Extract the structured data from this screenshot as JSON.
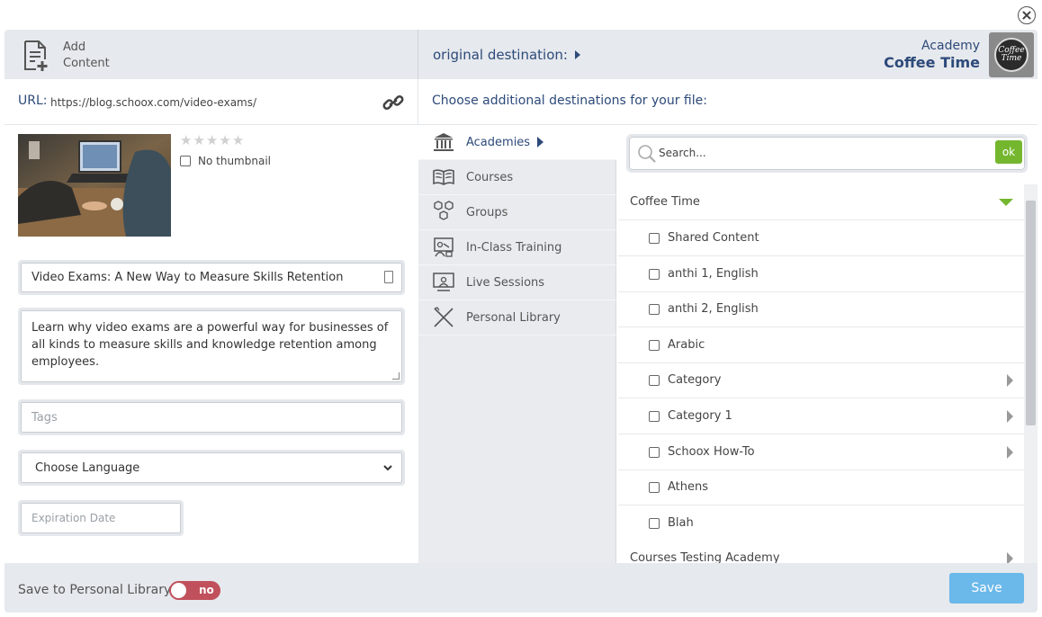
{
  "header": {
    "add_content_line1": "Add",
    "add_content_line2": "Content",
    "original_destination": "original destination:",
    "academy_label": "Academy",
    "academy_name": "Coffee Time",
    "logo_text": "Coffee Time"
  },
  "url": {
    "label": "URL:",
    "value": "https://blog.schoox.com/video-exams/"
  },
  "choose_destinations": "Choose additional destinations for your file:",
  "thumbnail": {
    "rating": 0,
    "no_thumbnail_label": "No thumbnail"
  },
  "form": {
    "title_value": "Video Exams: A New Way to Measure Skills Retention",
    "description_value": "Learn why video exams are a powerful way for businesses of all kinds to measure skills and knowledge retention among employees.",
    "tags_placeholder": "Tags",
    "language_value": "Choose Language",
    "expiration_placeholder": "Expiration Date"
  },
  "nav": {
    "items": [
      {
        "label": "Academies",
        "icon": "academy-icon",
        "active": true
      },
      {
        "label": "Courses",
        "icon": "book-icon",
        "active": false
      },
      {
        "label": "Groups",
        "icon": "hexagons-icon",
        "active": false
      },
      {
        "label": "In-Class Training",
        "icon": "classroom-icon",
        "active": false
      },
      {
        "label": "Live Sessions",
        "icon": "presentation-icon",
        "active": false
      },
      {
        "label": "Personal Library",
        "icon": "tools-icon",
        "active": false
      }
    ]
  },
  "search": {
    "placeholder": "Search...",
    "ok_label": "ok"
  },
  "list": {
    "group1": "Coffee Time",
    "items": [
      {
        "label": "Shared Content"
      },
      {
        "label": "anthi 1, English"
      },
      {
        "label": "anthi 2, English"
      },
      {
        "label": "Arabic"
      },
      {
        "label": "Category"
      },
      {
        "label": "Category 1"
      },
      {
        "label": "Schoox How-To"
      },
      {
        "label": "Athens"
      },
      {
        "label": "Blah"
      }
    ],
    "group2": "Courses Testing Academy"
  },
  "footer": {
    "save_personal_label": "Save to Personal Library",
    "toggle_label": "no",
    "save_label": "Save"
  },
  "colors": {
    "accent_blue": "#2d4a7a",
    "ok_green": "#74b72e",
    "toggle_red": "#c0505b",
    "save_blue": "#6bb8ea"
  }
}
